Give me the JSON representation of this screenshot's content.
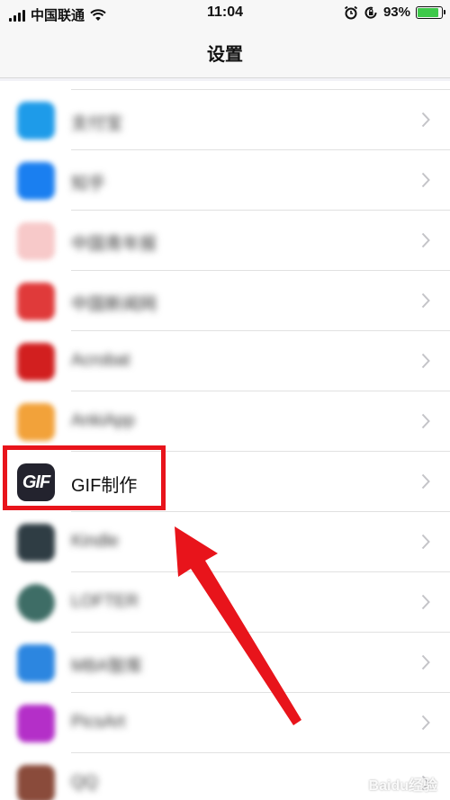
{
  "status_bar": {
    "carrier": "中国联通",
    "time": "11:04",
    "battery": "93%",
    "battery_level": 0.93
  },
  "nav": {
    "title": "设置"
  },
  "rows": [
    {
      "label": "支付宝",
      "icon_color": "#1e9be9"
    },
    {
      "label": "知乎",
      "icon_color": "#1a7ff0"
    },
    {
      "label": "中国青年报",
      "icon_color": "#f7c9c9"
    },
    {
      "label": "中国新闻网",
      "icon_color": "#e03a3a"
    },
    {
      "label": "Acrobat",
      "icon_color": "#d21f1f"
    },
    {
      "label": "AnkiApp",
      "icon_color": "#f2a23a"
    },
    {
      "label": "GIF制作",
      "icon_color": "#23232e",
      "icon_text": "GIF"
    },
    {
      "label": "Kindle",
      "icon_color": "#2f3d44"
    },
    {
      "label": "LOFTER",
      "icon_color": "#3e6d66"
    },
    {
      "label": "MBA智库",
      "icon_color": "#2c86e0"
    },
    {
      "label": "PicsArt",
      "icon_color": "#b42fc8"
    },
    {
      "label": "QQ",
      "icon_color": "#8a4b3b"
    }
  ],
  "watermark": "Baidu经验",
  "colors": {
    "highlight": "#e8141b",
    "arrow": "#e8141b"
  }
}
